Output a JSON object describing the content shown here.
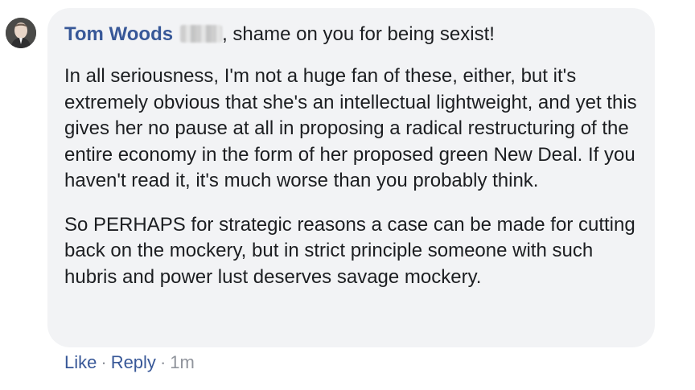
{
  "comment": {
    "author": "Tom Woods",
    "intro_text": ", shame on you for being sexist!",
    "paragraphs": [
      "In all seriousness, I'm not a huge fan of these, either, but it's extremely obvious that she's an intellectual lightweight, and yet this gives her no pause at all in proposing a radical restructuring of the entire economy in the form of her proposed green New Deal. If you haven't read it, it's much worse than you probably think.",
      "So PERHAPS for strategic reasons a case can be made for cutting back on the mockery, but in strict principle someone with such hubris and power lust deserves savage mockery."
    ],
    "actions": {
      "like": "Like",
      "reply": "Reply",
      "separator": "·",
      "timestamp": "1m"
    }
  },
  "colors": {
    "author_link": "#385898",
    "bubble_background": "#f2f3f5",
    "body_text": "#1c1e21",
    "meta_text": "#90949c"
  }
}
